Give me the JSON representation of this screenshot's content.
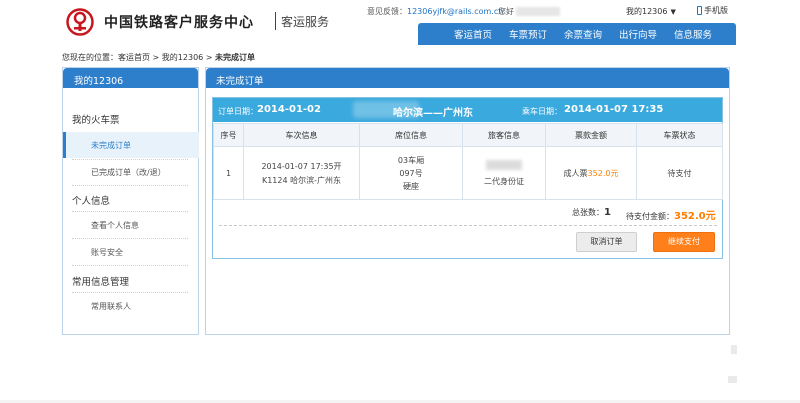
{
  "header": {
    "brand": "中国铁路客户服务中心",
    "brand_sub": "客运服务",
    "feedback_label": "意见反馈：",
    "feedback_email": "12306yjfk@rails.com.cn",
    "greeting": "您好",
    "my12306": "我的12306",
    "mobile": "手机版",
    "nav": [
      "客运首页",
      "车票预订",
      "余票查询",
      "出行向导",
      "信息服务"
    ]
  },
  "breadcrumb": {
    "prefix": "您现在的位置：",
    "home": "客运首页",
    "sep1": " > ",
    "my": "我的12306",
    "sep2": " > ",
    "current": "未完成订单"
  },
  "sidebar": {
    "title": "我的12306",
    "groups": [
      {
        "label": "我的火车票",
        "links": [
          "未完成订单",
          "已完成订单（改/退）"
        ]
      },
      {
        "label": "个人信息",
        "links": [
          "查看个人信息",
          "账号安全"
        ]
      },
      {
        "label": "常用信息管理",
        "links": [
          "常用联系人"
        ]
      }
    ]
  },
  "main": {
    "title": "未完成订单",
    "order_date_label": "订单日期：",
    "order_date": "2014-01-02",
    "route": "哈尔滨——广州东",
    "ride_date_label": "乘车日期：",
    "ride_date": "2014-01-07 17:35",
    "columns": [
      "序号",
      "车次信息",
      "席位信息",
      "旅客信息",
      "票款金额",
      "车票状态"
    ],
    "rows": [
      {
        "index": "1",
        "train_line1": "2014-01-07 17:35开",
        "train_line2": "K1124 哈尔滨-广州东",
        "seat_line1": "03车厢",
        "seat_line2": "097号",
        "seat_line3": "硬座",
        "passenger_id": "二代身份证",
        "price_prefix": "成人票",
        "price": "352.0元",
        "status": "待支付"
      }
    ],
    "total_count_label": "总张数：",
    "total_count": "1",
    "total_amount_label": "待支付金额：",
    "total_amount": "352.0元",
    "cancel_label": "取消订单",
    "pay_label": "继续支付"
  },
  "colors": {
    "accent": "#2d7fcb",
    "order_bar": "#3aa9dd",
    "price": "#ff7d00",
    "pay_button": "#ff7f1a"
  }
}
